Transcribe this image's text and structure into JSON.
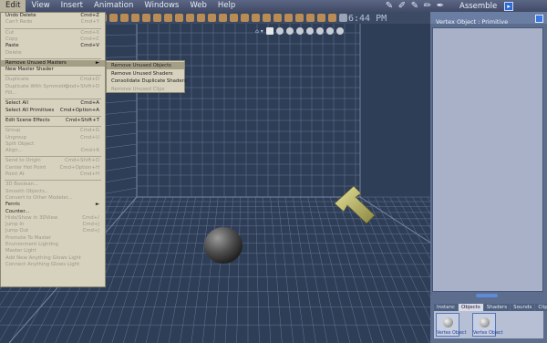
{
  "menubar": {
    "items": [
      "Edit",
      "View",
      "Insert",
      "Animation",
      "Windows",
      "Web",
      "Help"
    ]
  },
  "titlebar": {
    "room": "Assemble"
  },
  "clock": "6:44 PM",
  "panel": {
    "title": "Vertex Object : Primitive",
    "tabs": [
      "Instanc",
      "Objects",
      "Shaders",
      "Sounds",
      "Clips"
    ],
    "objects": [
      "Vertex Object",
      "Vertex Object"
    ]
  },
  "edit_menu": [
    {
      "label": "Undo Delete",
      "shortcut": "Cmd+Z",
      "disabled": false
    },
    {
      "label": "Can't Redo",
      "shortcut": "Cmd+Y",
      "disabled": true
    },
    {
      "sep": true
    },
    {
      "label": "Cut",
      "shortcut": "Cmd+X",
      "disabled": true
    },
    {
      "label": "Copy",
      "shortcut": "Cmd+C",
      "disabled": true
    },
    {
      "label": "Paste",
      "shortcut": "Cmd+V",
      "disabled": false
    },
    {
      "label": "Delete",
      "shortcut": "",
      "disabled": true
    },
    {
      "sep": true
    },
    {
      "label": "Remove Unused Masters",
      "shortcut": "►",
      "disabled": false,
      "highlighted": true
    },
    {
      "label": "New Master Shader",
      "shortcut": "",
      "disabled": false
    },
    {
      "sep": true
    },
    {
      "label": "Duplicate",
      "shortcut": "Cmd+D",
      "disabled": true
    },
    {
      "label": "Duplicate With Symmetry...",
      "shortcut": "Cmd+Shift+D",
      "disabled": true
    },
    {
      "label": "Fill...",
      "shortcut": "",
      "disabled": true
    },
    {
      "sep": true
    },
    {
      "label": "Select All",
      "shortcut": "Cmd+A",
      "disabled": false
    },
    {
      "label": "Select All Primitives",
      "shortcut": "Cmd+Option+A",
      "disabled": false
    },
    {
      "sep": true
    },
    {
      "label": "Edit Scene Effects",
      "shortcut": "Cmd+Shift+T",
      "disabled": false
    },
    {
      "sep": true
    },
    {
      "label": "Group",
      "shortcut": "Cmd+G",
      "disabled": true
    },
    {
      "label": "Ungroup",
      "shortcut": "Cmd+U",
      "disabled": true
    },
    {
      "label": "Split Object",
      "shortcut": "",
      "disabled": true
    },
    {
      "label": "Align...",
      "shortcut": "Cmd+K",
      "disabled": true
    },
    {
      "sep": true
    },
    {
      "label": "Send to Origin",
      "shortcut": "Cmd+Shift+O",
      "disabled": true
    },
    {
      "label": "Center Hot Point",
      "shortcut": "Cmd+Option+H",
      "disabled": true
    },
    {
      "label": "Point At",
      "shortcut": "Cmd+H",
      "disabled": true
    },
    {
      "sep": true
    },
    {
      "label": "3D Boolean...",
      "shortcut": "",
      "disabled": true
    },
    {
      "label": "Smooth Objects...",
      "shortcut": "",
      "disabled": true
    },
    {
      "label": "Convert to Other Modeler...",
      "shortcut": "",
      "disabled": true
    },
    {
      "label": "Fenric",
      "shortcut": "►",
      "disabled": false
    },
    {
      "label": "Counter...",
      "shortcut": "",
      "disabled": false
    },
    {
      "label": "Hide/Show in 3DView",
      "shortcut": "Cmd+/",
      "disabled": true
    },
    {
      "label": "Jump In",
      "shortcut": "Cmd+J",
      "disabled": true
    },
    {
      "label": "Jump Out",
      "shortcut": "Cmd+J",
      "disabled": true
    },
    {
      "label": "Promote To Master",
      "shortcut": "",
      "disabled": true
    },
    {
      "label": "Environment Lighting",
      "shortcut": "",
      "disabled": true
    },
    {
      "label": "Master Light",
      "shortcut": "",
      "disabled": true
    },
    {
      "label": "Add New Anything Glows Light",
      "shortcut": "",
      "disabled": true
    },
    {
      "label": "Connect Anything Glows Light",
      "shortcut": "",
      "disabled": true
    }
  ],
  "sub_menu": [
    {
      "label": "Remove Unused Objects",
      "highlighted": true,
      "disabled": false
    },
    {
      "label": "Remove Unused Shaders",
      "disabled": false
    },
    {
      "label": "Consolidate Duplicate Shaders",
      "disabled": false
    },
    {
      "label": "Remove Unused Clips",
      "disabled": true
    }
  ]
}
